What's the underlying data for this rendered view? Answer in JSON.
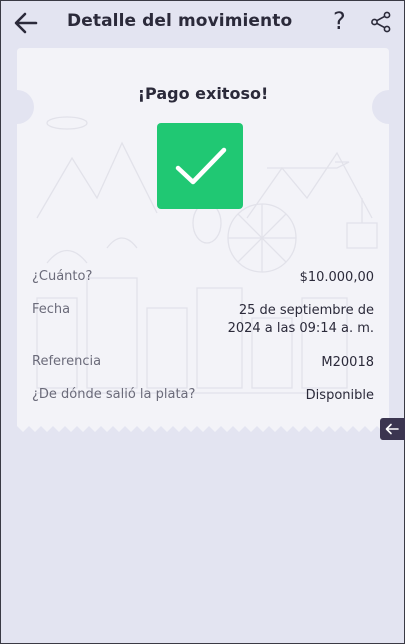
{
  "header": {
    "title": "Detalle del movimiento",
    "help_label": "?"
  },
  "receipt": {
    "heading": "¡Pago exitoso!",
    "rows": [
      {
        "label": "¿Cuánto?",
        "value": "$10.000,00"
      },
      {
        "label": "Fecha",
        "value_line1": "25 de septiembre de",
        "value_line2": "2024 a las 09:14 a. m."
      },
      {
        "label": "Referencia",
        "value": "M20018"
      },
      {
        "label": "¿De dónde salió la plata?",
        "value": "Disponible"
      }
    ]
  },
  "colors": {
    "background": "#e3e4f1",
    "card": "#f3f3f8",
    "success": "#20c873",
    "sidetab": "#3b3550"
  },
  "icons": [
    "back-arrow-icon",
    "share-icon",
    "checkmark-icon",
    "collapse-arrow-icon"
  ]
}
